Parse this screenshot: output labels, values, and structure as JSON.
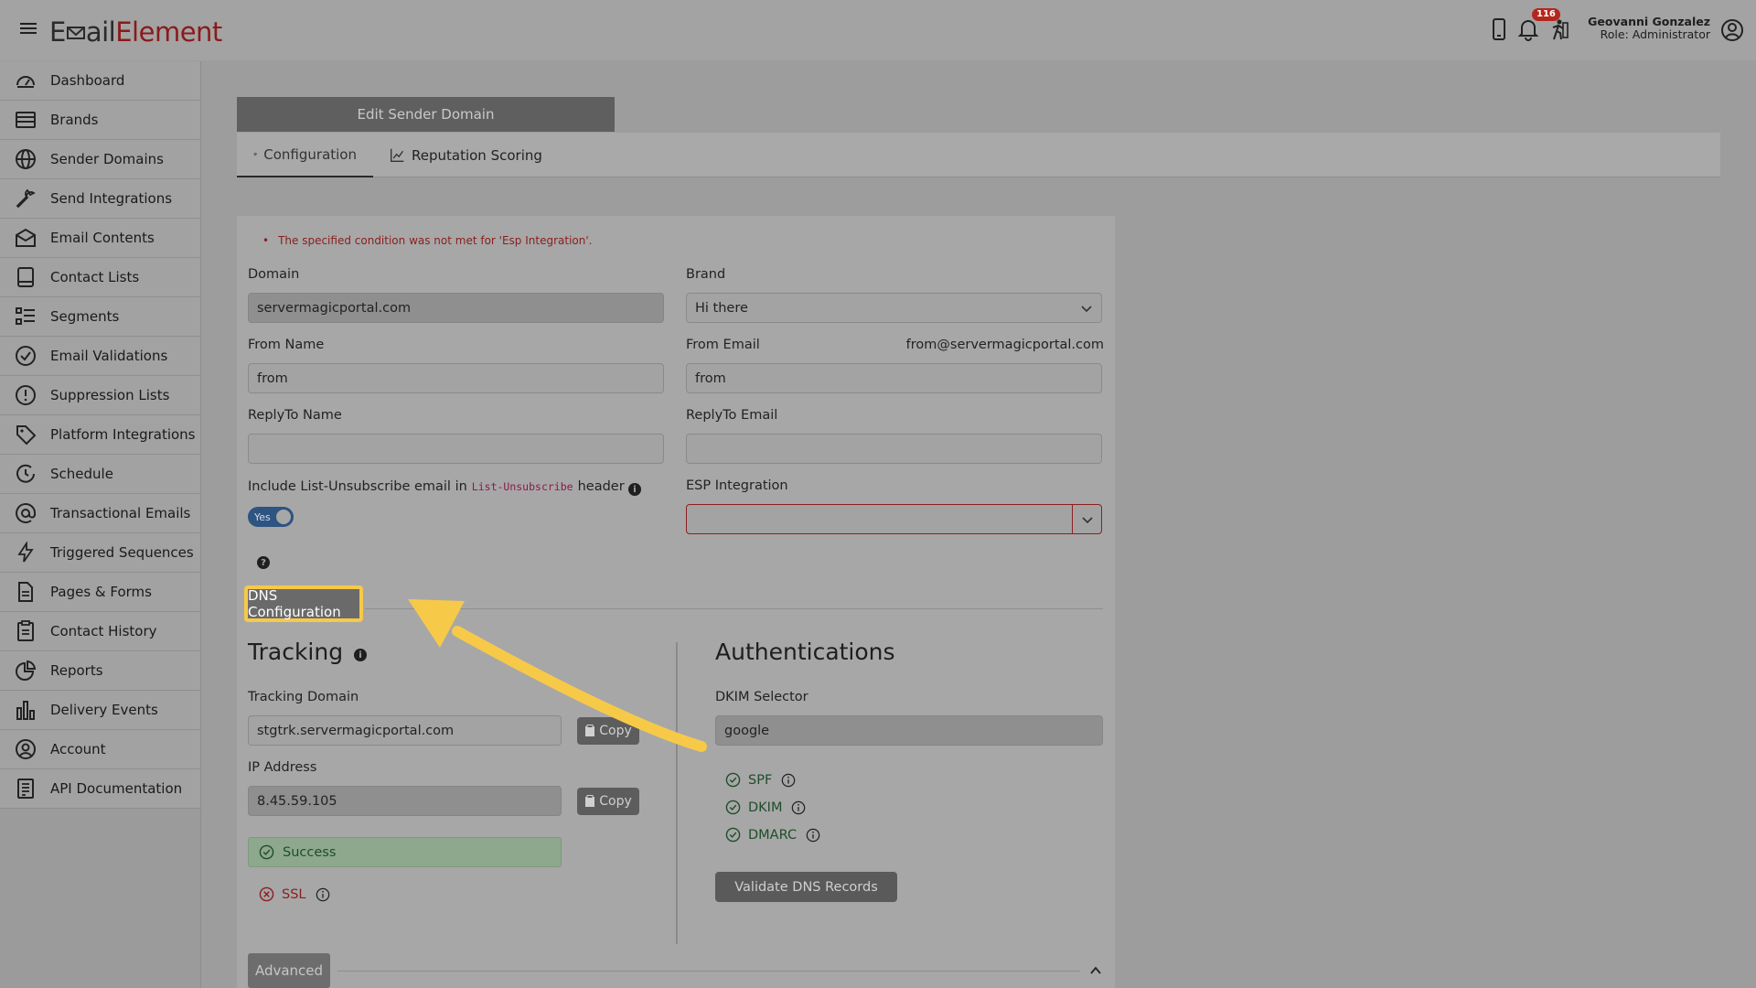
{
  "header": {
    "logo_part1": "E",
    "logo_part2": "ail",
    "logo_part3": "Element",
    "notification_count": "116",
    "user_name": "Geovanni Gonzalez",
    "user_role": "Role: Administrator"
  },
  "sidebar": {
    "items": [
      {
        "label": "Dashboard",
        "icon": "dashboard-icon"
      },
      {
        "label": "Brands",
        "icon": "brands-icon"
      },
      {
        "label": "Sender Domains",
        "icon": "globe-icon"
      },
      {
        "label": "Send Integrations",
        "icon": "wrench-icon"
      },
      {
        "label": "Email Contents",
        "icon": "envelope-icon"
      },
      {
        "label": "Contact Lists",
        "icon": "book-icon"
      },
      {
        "label": "Segments",
        "icon": "segments-icon"
      },
      {
        "label": "Email Validations",
        "icon": "check-circle-icon"
      },
      {
        "label": "Suppression Lists",
        "icon": "exclamation-circle-icon"
      },
      {
        "label": "Platform Integrations",
        "icon": "tag-icon"
      },
      {
        "label": "Schedule",
        "icon": "clock-icon"
      },
      {
        "label": "Transactional Emails",
        "icon": "at-icon"
      },
      {
        "label": "Triggered Sequences",
        "icon": "lightning-icon"
      },
      {
        "label": "Pages & Forms",
        "icon": "file-icon"
      },
      {
        "label": "Contact History",
        "icon": "clipboard-icon"
      },
      {
        "label": "Reports",
        "icon": "pie-chart-icon"
      },
      {
        "label": "Delivery Events",
        "icon": "bar-chart-icon"
      },
      {
        "label": "Account",
        "icon": "user-circle-icon"
      },
      {
        "label": "API Documentation",
        "icon": "document-icon"
      }
    ]
  },
  "page": {
    "title": "Edit Sender Domain",
    "tabs": [
      {
        "label": "Configuration",
        "icon": "gear-icon",
        "active": true
      },
      {
        "label": "Reputation Scoring",
        "icon": "line-chart-icon",
        "active": false
      }
    ]
  },
  "form": {
    "error": "The specified condition was not met for 'Esp Integration'.",
    "domain_label": "Domain",
    "domain_value": "servermagicportal.com",
    "brand_label": "Brand",
    "brand_value": "Hi there",
    "from_name_label": "From Name",
    "from_name_value": "from",
    "from_email_label": "From Email",
    "from_email_hint": "from@servermagicportal.com",
    "from_email_value": "from",
    "replyto_name_label": "ReplyTo Name",
    "replyto_name_value": "",
    "replyto_email_label": "ReplyTo Email",
    "replyto_email_value": "",
    "unsubscribe_label_pre": "Include List-Unsubscribe email in",
    "unsubscribe_code": "List-Unsubscribe",
    "unsubscribe_label_post": "header",
    "unsubscribe_toggle": "Yes",
    "esp_label": "ESP Integration",
    "esp_value": ""
  },
  "dns": {
    "button_label": "DNS Configuration",
    "tracking_title": "Tracking",
    "tracking_domain_label": "Tracking Domain",
    "tracking_domain_value": "stgtrk.servermagicportal.com",
    "copy_label": "Copy",
    "ip_label": "IP Address",
    "ip_value": "8.45.59.105",
    "success_label": "Success",
    "ssl_label": "SSL",
    "auth_title": "Authentications",
    "dkim_selector_label": "DKIM Selector",
    "dkim_selector_value": "google",
    "checks": [
      "SPF",
      "DKIM",
      "DMARC"
    ],
    "validate_label": "Validate DNS Records",
    "advanced_label": "Advanced"
  },
  "colors": {
    "accent_highlight": "#f7c948",
    "error_red": "#8e1e1e",
    "success_green": "#1f4d2a",
    "toggle_blue": "#2e5481"
  }
}
